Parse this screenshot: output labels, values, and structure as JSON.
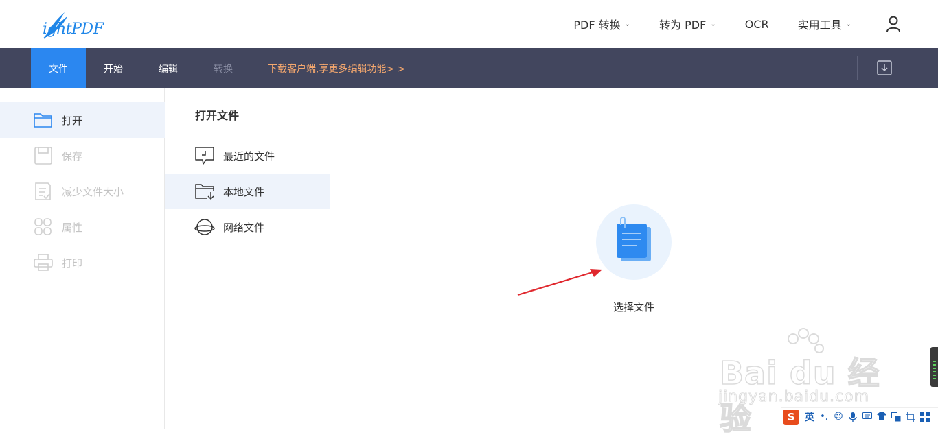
{
  "app": {
    "logo_text": "ightPDF"
  },
  "topnav": {
    "items": [
      {
        "label": "PDF 转换",
        "has_dropdown": true
      },
      {
        "label": "转为 PDF",
        "has_dropdown": true
      },
      {
        "label": "OCR",
        "has_dropdown": false
      },
      {
        "label": "实用工具",
        "has_dropdown": true
      }
    ],
    "user_icon": "user-icon"
  },
  "toolbar": {
    "tabs": [
      {
        "label": "文件",
        "state": "active"
      },
      {
        "label": "开始",
        "state": "normal"
      },
      {
        "label": "编辑",
        "state": "normal"
      },
      {
        "label": "转换",
        "state": "disabled"
      }
    ],
    "promo": "下载客户端,享更多编辑功能> >",
    "download_icon": "download-icon"
  },
  "left_menu": {
    "items": [
      {
        "label": "打开",
        "icon": "folder-icon",
        "state": "active"
      },
      {
        "label": "保存",
        "icon": "save-icon",
        "state": "disabled"
      },
      {
        "label": "减少文件大小",
        "icon": "compress-icon",
        "state": "disabled"
      },
      {
        "label": "属性",
        "icon": "properties-icon",
        "state": "disabled"
      },
      {
        "label": "打印",
        "icon": "printer-icon",
        "state": "disabled"
      }
    ]
  },
  "open_panel": {
    "title": "打开文件",
    "items": [
      {
        "label": "最近的文件",
        "icon": "recent-icon",
        "state": "normal"
      },
      {
        "label": "本地文件",
        "icon": "local-folder-icon",
        "state": "active"
      },
      {
        "label": "网络文件",
        "icon": "planet-icon",
        "state": "normal"
      }
    ]
  },
  "main": {
    "choose_file_label": "选择文件"
  },
  "watermark": {
    "line1": "Bai du 经验",
    "line2": "jingyan.baidu.com"
  },
  "ime": {
    "logo": "S",
    "mode": "英"
  },
  "colors": {
    "accent": "#2b87f0",
    "toolbar_bg": "#42465e",
    "promo": "#f5a86e",
    "active_row": "#eef3fb",
    "arrow": "#e0282e"
  }
}
